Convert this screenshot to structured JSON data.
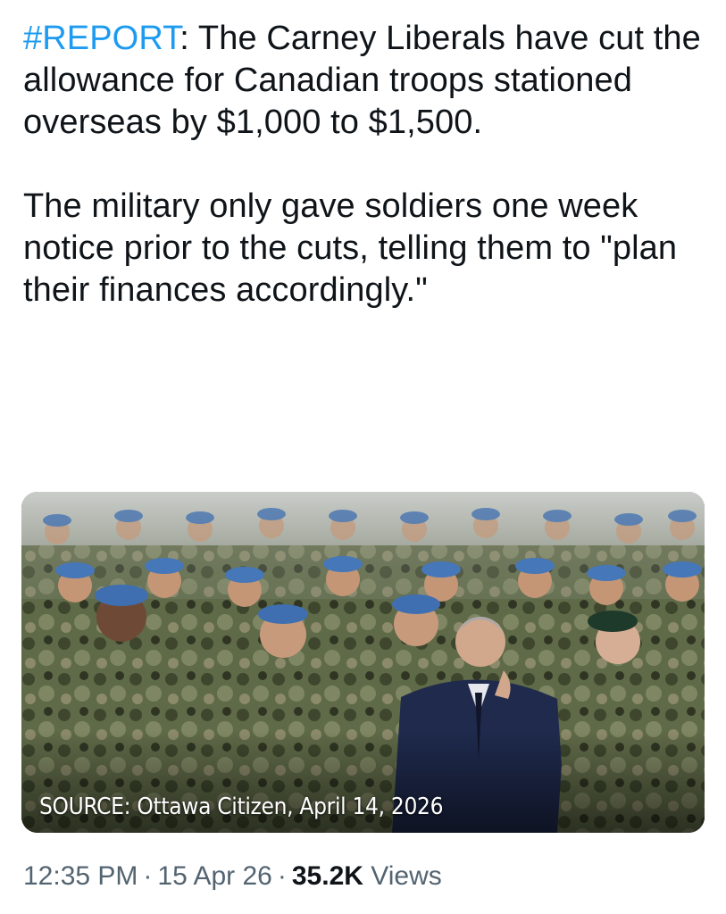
{
  "tweet": {
    "hashtag": "#REPORT",
    "text_line1_rest": ": The Carney Liberals have cut the allowance for Canadian troops stationed overseas by $1,000 to $1,500.",
    "paragraph2": "The military only gave soldiers one week notice prior to the cuts, telling them to \"plan their finances accordingly.\""
  },
  "media": {
    "caption": "SOURCE: Ottawa Citizen, April 14, 2026"
  },
  "meta": {
    "time": "12:35 PM",
    "separator": "·",
    "date": "15 Apr 26",
    "views_count": "35.2K",
    "views_label": "Views"
  },
  "colors": {
    "hashtag": "#1d9bf0",
    "text": "#0f1419",
    "meta": "#536471"
  }
}
